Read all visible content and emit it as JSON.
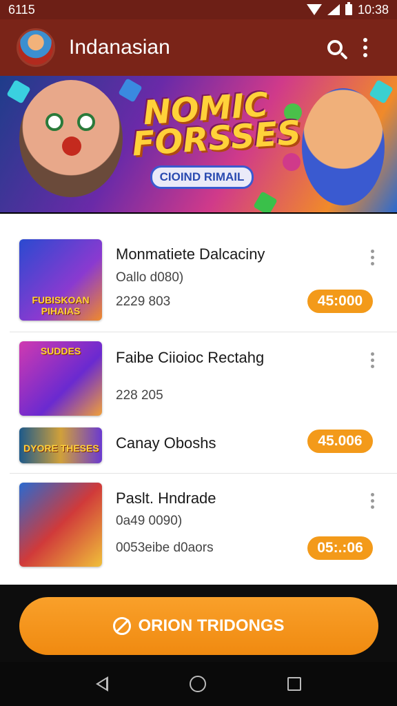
{
  "status_bar": {
    "time_left": "6115",
    "time_right": "10:38"
  },
  "app_bar": {
    "title": "Indanasian",
    "avatar_icon": "avatar-icon",
    "search_icon": "search-icon",
    "menu_icon": "more-vert-icon"
  },
  "banner": {
    "title": "NOMIC FORSSES",
    "subtitle": "CIOIND RIMAIL"
  },
  "items": [
    {
      "title": "Monmatiete Dalcaciny",
      "line1": "Oallo d080)",
      "line2": "2229 803",
      "price": "45:000",
      "thumb_text": "FUBISKOAN PIHAIAS"
    },
    {
      "title": "Faibe Ciioioc Rectahg",
      "line1": "",
      "line2": "228 205",
      "price": "",
      "thumb_text": "SUDDES"
    },
    {
      "title": "Canay Oboshs",
      "line1": "",
      "line2": "",
      "price": "45.006",
      "thumb_text": "DYORE THESES"
    },
    {
      "title": "Paslt. Hndrade",
      "line1": "0a49 0090)",
      "line2": "0053eibe d0aors",
      "price": "05:.:06",
      "thumb_text": ""
    }
  ],
  "cta": {
    "label": "ORION TRIDONGS",
    "icon": "block-icon"
  },
  "nav": {
    "back_icon": "back-icon",
    "home_icon": "home-icon",
    "recent_icon": "recent-apps-icon"
  }
}
